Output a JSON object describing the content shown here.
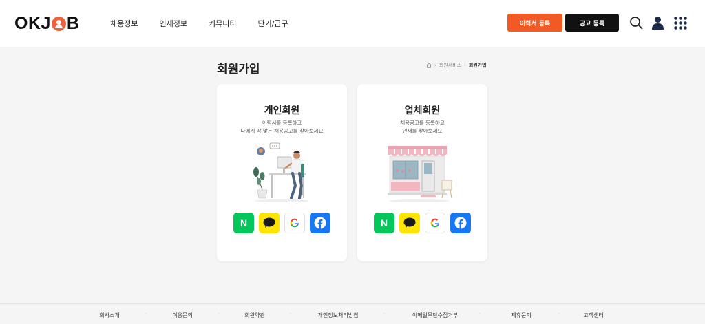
{
  "header": {
    "logo_text": "OKJOB",
    "nav": [
      "채용정보",
      "인재정보",
      "커뮤니티",
      "단기/급구"
    ],
    "resume_button": "이력서 등록",
    "job_button": "공고 등록"
  },
  "page": {
    "title": "회원가입",
    "breadcrumb": [
      "회원서비스",
      "회원가입"
    ]
  },
  "cards": [
    {
      "title": "개인회원",
      "desc_line1": "이력서를 등록하고",
      "desc_line2": "나에게 딱 맞는 채용공고를 찾아보세요",
      "social": [
        "N"
      ]
    },
    {
      "title": "업체회원",
      "desc_line1": "채용공고를 등록하고",
      "desc_line2": "인재를 찾아보세요",
      "social": [
        "N"
      ]
    }
  ],
  "footer": {
    "links": [
      "회사소개",
      "이용문의",
      "회원약관",
      "개인정보처리방침",
      "이메일무단수집거부",
      "제휴문의",
      "고객센터"
    ]
  },
  "colors": {
    "brand_orange": "#f15a24",
    "naver": "#03c75a",
    "kakao": "#fee500",
    "facebook": "#1877f2"
  },
  "icons": [
    "search-icon",
    "user-icon",
    "grid-menu-icon",
    "home-icon",
    "naver-icon",
    "kakao-icon",
    "google-icon",
    "facebook-icon"
  ]
}
